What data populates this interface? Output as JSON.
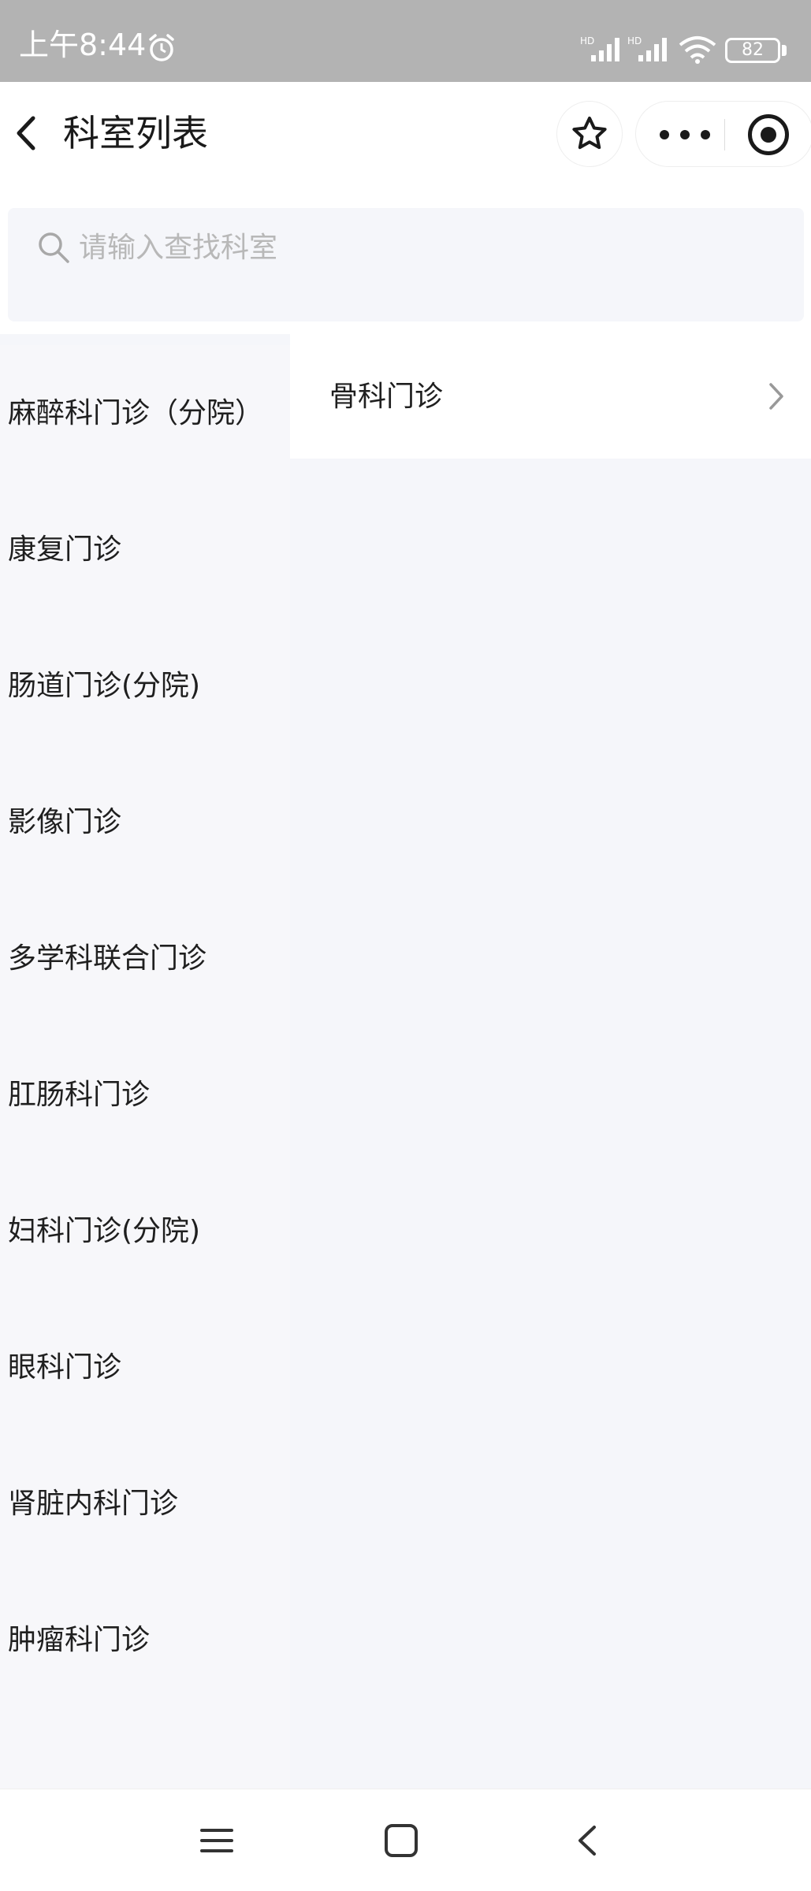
{
  "status_bar": {
    "time": "上午8:44",
    "battery": "82"
  },
  "nav": {
    "title": "科室列表"
  },
  "search": {
    "placeholder": "请输入查找科室"
  },
  "departments": [
    "麻醉科门诊（分院）",
    "康复门诊",
    "肠道门诊(分院)",
    "影像门诊",
    "多学科联合门诊",
    "肛肠科门诊",
    "妇科门诊(分院)",
    "眼科门诊",
    "肾脏内科门诊",
    "肿瘤科门诊"
  ],
  "sub_departments": [
    "骨科门诊"
  ],
  "icons": {
    "alarm": "alarm-icon",
    "signal": "signal-icon",
    "wifi": "wifi-icon",
    "back": "back-icon",
    "star": "star-icon",
    "more": "more-icon",
    "target": "target-icon",
    "search": "search-icon",
    "chevron": "chevron-right-icon",
    "menu": "menu-icon",
    "home": "home-icon",
    "nav_back": "nav-back-icon"
  },
  "colors": {
    "status_bar": "#b3b3b3",
    "panel_bg": "#f5f6fa",
    "text": "#1f1f1f",
    "placeholder": "#b8b8b8"
  }
}
